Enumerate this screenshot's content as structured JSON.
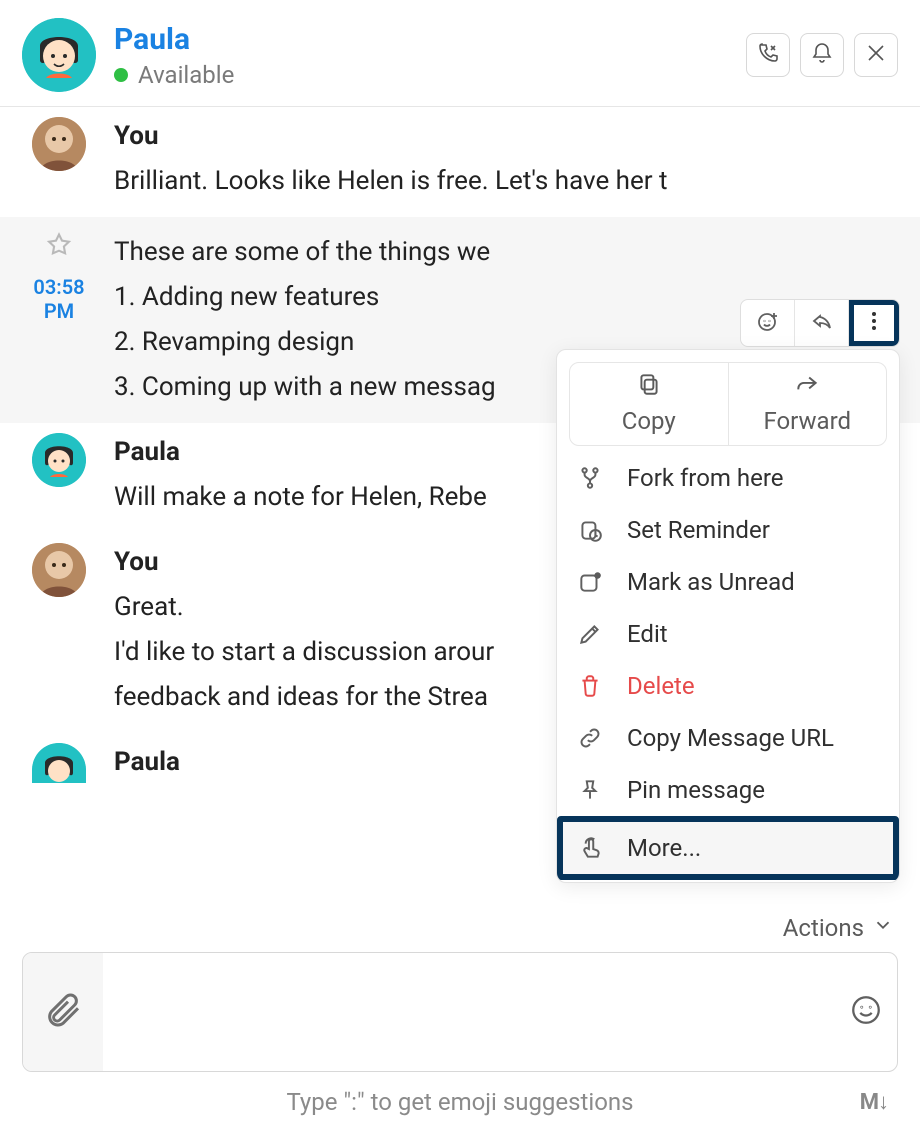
{
  "header": {
    "name": "Paula",
    "status": "Available",
    "status_color": "#2fbf44"
  },
  "messages": {
    "m1": {
      "sender": "You",
      "text": "Brilliant. Looks like Helen is free. Let's have her t"
    },
    "m2": {
      "timestamp_line1": "03:58",
      "timestamp_line2": "PM",
      "line0": "These are some of the things we",
      "line1": "1. Adding new features",
      "line2": "2. Revamping design",
      "line3": "3. Coming up with a new messag"
    },
    "m3": {
      "sender": "Paula",
      "text": "Will make a note for Helen, Rebe"
    },
    "m4": {
      "sender": "You",
      "line1": "Great.",
      "line2": "I'd like to start a discussion arour",
      "line3": "feedback and ideas for the Strea"
    },
    "m5": {
      "sender": "Paula"
    }
  },
  "hoverbar": {
    "react": "react",
    "reply": "reply",
    "more": "more"
  },
  "ctx": {
    "copy": "Copy",
    "forward": "Forward",
    "fork": "Fork from here",
    "reminder": "Set Reminder",
    "unread": "Mark as Unread",
    "edit": "Edit",
    "delete": "Delete",
    "copyurl": "Copy Message URL",
    "pin": "Pin message",
    "more": "More..."
  },
  "footer": {
    "actions": "Actions",
    "hint": "Type \":\" to get emoji suggestions",
    "md": "M↓"
  }
}
